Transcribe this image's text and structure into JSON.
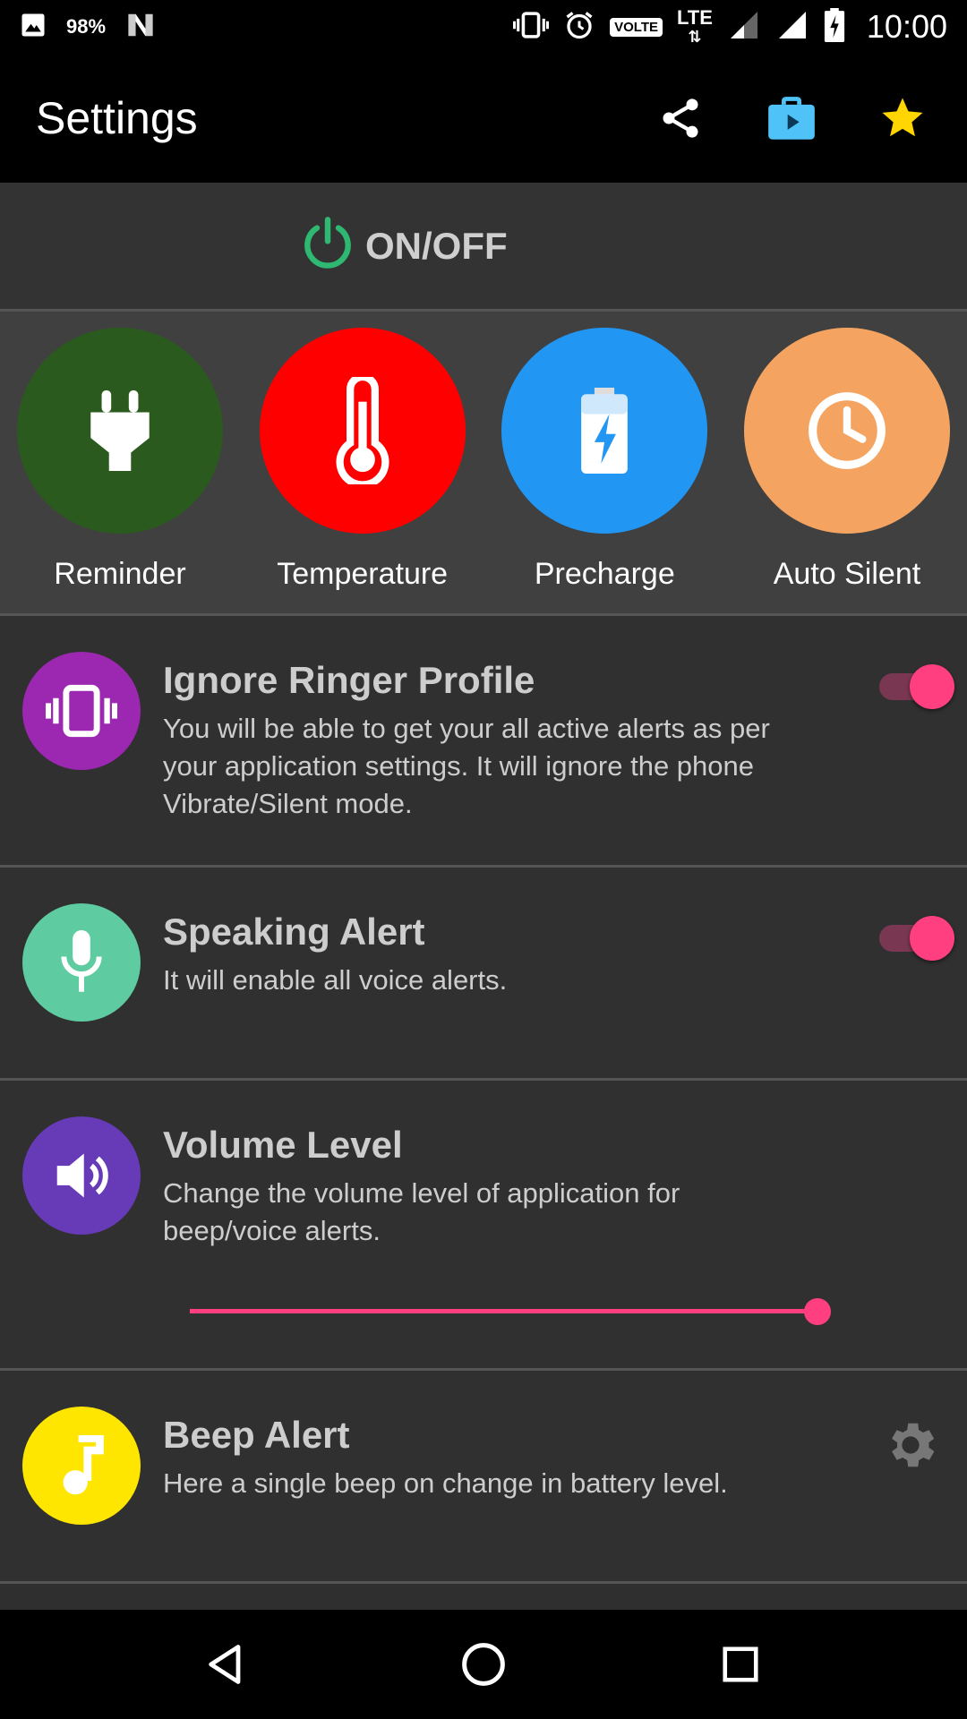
{
  "status_bar": {
    "battery_percent": "98%",
    "volte": "VOLTE",
    "lte": "LTE",
    "time": "10:00"
  },
  "app_bar": {
    "title": "Settings",
    "actions": [
      {
        "name": "share-icon"
      },
      {
        "name": "play-store-bag-icon",
        "color": "#4fc3f7"
      },
      {
        "name": "star-icon",
        "color": "#ffd600"
      }
    ]
  },
  "master_switch": {
    "label": "ON/OFF",
    "icon": "power-icon",
    "icon_color": "#2eb872",
    "checked": true
  },
  "categories": [
    {
      "label": "Reminder",
      "icon": "plug-icon",
      "color": "#2a5a1e"
    },
    {
      "label": "Temperature",
      "icon": "thermometer-icon",
      "color": "#ff0000"
    },
    {
      "label": "Precharge",
      "icon": "battery-charging-icon",
      "color": "#2196f3"
    },
    {
      "label": "Auto Silent",
      "icon": "clock-icon",
      "color": "#f4a460"
    }
  ],
  "settings": [
    {
      "title": "Ignore Ringer Profile",
      "description": "You will be able to get your all active alerts as per your application settings. It will ignore the phone Vibrate/Silent mode.",
      "icon": "vibrate-icon",
      "icon_color": "#9c27b0",
      "control": "toggle",
      "checked": true
    },
    {
      "title": "Speaking Alert",
      "description": "It will enable all voice alerts.",
      "icon": "microphone-icon",
      "icon_color": "#5ecba1",
      "control": "toggle",
      "checked": true
    },
    {
      "title": "Volume Level",
      "description": "Change the volume level of application for beep/voice alerts.",
      "icon": "volume-icon",
      "icon_color": "#673ab7",
      "control": "slider",
      "value_percent": 100
    },
    {
      "title": "Beep Alert",
      "description": "Here a single beep on change in battery level.",
      "icon": "music-note-icon",
      "icon_color": "#ffe600",
      "control": "gear"
    }
  ],
  "colors": {
    "accent": "#ff3f7f",
    "background": "#303030",
    "divider": "#555555"
  }
}
